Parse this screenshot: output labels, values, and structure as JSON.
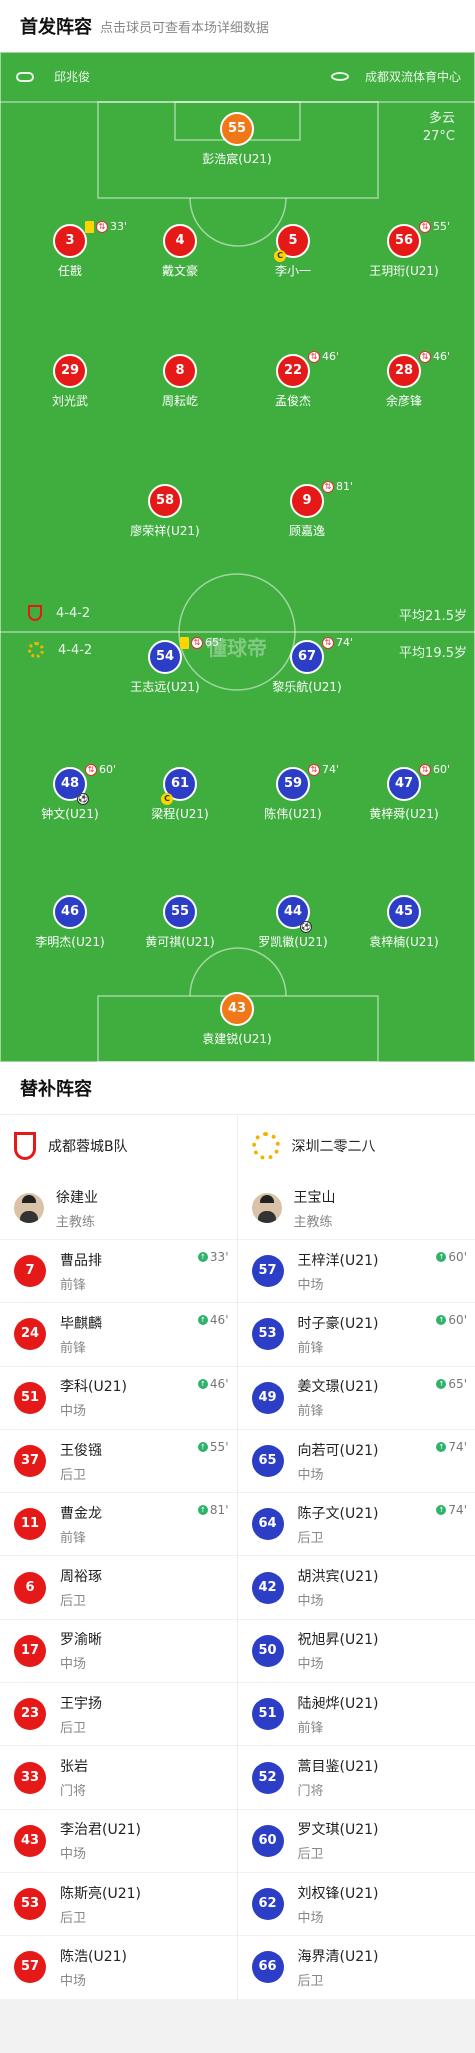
{
  "header": {
    "title": "首发阵容",
    "subtitle": "点击球员可查看本场详细数据"
  },
  "match": {
    "referee": "邱兆俊",
    "venue": "成都双流体育中心",
    "weather": "多云",
    "temperature": "27°C"
  },
  "watermark": "懂球帝",
  "home": {
    "formation": "4-4-2",
    "avg_age": "平均21.5岁",
    "players": [
      {
        "num": "55",
        "name": "彭浩宸(U21)",
        "gk": true
      },
      {
        "num": "3",
        "name": "任戡",
        "card": true,
        "sub_min": "33'"
      },
      {
        "num": "4",
        "name": "戴文豪"
      },
      {
        "num": "5",
        "name": "李小一",
        "captain": true
      },
      {
        "num": "56",
        "name": "王玥珩(U21)",
        "sub_min": "55'"
      },
      {
        "num": "29",
        "name": "刘光武"
      },
      {
        "num": "8",
        "name": "周耘屹"
      },
      {
        "num": "22",
        "name": "孟俊杰",
        "sub_min": "46'"
      },
      {
        "num": "28",
        "name": "余彦锋",
        "sub_min": "46'"
      },
      {
        "num": "58",
        "name": "廖荣祥(U21)"
      },
      {
        "num": "9",
        "name": "顾嘉逸",
        "sub_min": "81'"
      }
    ]
  },
  "away": {
    "formation": "4-4-2",
    "avg_age": "平均19.5岁",
    "players": [
      {
        "num": "54",
        "name": "王志远(U21)",
        "card": true,
        "sub_min": "65'"
      },
      {
        "num": "67",
        "name": "黎乐航(U21)",
        "sub_min": "74'"
      },
      {
        "num": "48",
        "name": "钟文(U21)",
        "sub_min": "60'",
        "goal": true
      },
      {
        "num": "61",
        "name": "梁程(U21)",
        "captain": true
      },
      {
        "num": "59",
        "name": "陈伟(U21)",
        "sub_min": "74'"
      },
      {
        "num": "47",
        "name": "黄梓舜(U21)",
        "sub_min": "60'"
      },
      {
        "num": "46",
        "name": "李明杰(U21)"
      },
      {
        "num": "55",
        "name": "黄可祺(U21)"
      },
      {
        "num": "44",
        "name": "罗凯徽(U21)",
        "goal": true
      },
      {
        "num": "45",
        "name": "袁梓楠(U21)"
      },
      {
        "num": "43",
        "name": "袁建锐(U21)",
        "gk": true
      }
    ]
  },
  "subs": {
    "title": "替补阵容",
    "home": {
      "team": "成都蓉城B队",
      "coach": "徐建业",
      "coach_role": "主教练",
      "players": [
        {
          "num": "7",
          "name": "曹品排",
          "pos": "前锋",
          "min": "33'"
        },
        {
          "num": "24",
          "name": "毕麒麟",
          "pos": "前锋",
          "min": "46'"
        },
        {
          "num": "51",
          "name": "李科(U21)",
          "pos": "中场",
          "min": "46'"
        },
        {
          "num": "37",
          "name": "王俊镪",
          "pos": "后卫",
          "min": "55'"
        },
        {
          "num": "11",
          "name": "曹金龙",
          "pos": "前锋",
          "min": "81'"
        },
        {
          "num": "6",
          "name": "周裕琢",
          "pos": "后卫"
        },
        {
          "num": "17",
          "name": "罗渝晰",
          "pos": "中场"
        },
        {
          "num": "23",
          "name": "王宇扬",
          "pos": "后卫"
        },
        {
          "num": "33",
          "name": "张岩",
          "pos": "门将"
        },
        {
          "num": "43",
          "name": "李治君(U21)",
          "pos": "中场"
        },
        {
          "num": "53",
          "name": "陈斯亮(U21)",
          "pos": "后卫"
        },
        {
          "num": "57",
          "name": "陈浩(U21)",
          "pos": "中场"
        }
      ]
    },
    "away": {
      "team": "深圳二零二八",
      "coach": "王宝山",
      "coach_role": "主教练",
      "players": [
        {
          "num": "57",
          "name": "王梓洋(U21)",
          "pos": "中场",
          "min": "60'"
        },
        {
          "num": "53",
          "name": "时子豪(U21)",
          "pos": "前锋",
          "min": "60'"
        },
        {
          "num": "49",
          "name": "姜文璟(U21)",
          "pos": "前锋",
          "min": "65'"
        },
        {
          "num": "65",
          "name": "向若可(U21)",
          "pos": "中场",
          "min": "74'"
        },
        {
          "num": "64",
          "name": "陈子文(U21)",
          "pos": "后卫",
          "min": "74'"
        },
        {
          "num": "42",
          "name": "胡洪宾(U21)",
          "pos": "中场"
        },
        {
          "num": "50",
          "name": "祝旭昇(U21)",
          "pos": "中场"
        },
        {
          "num": "51",
          "name": "陆昶烨(U21)",
          "pos": "前锋"
        },
        {
          "num": "52",
          "name": "蒿目鉴(U21)",
          "pos": "门将"
        },
        {
          "num": "60",
          "name": "罗文琪(U21)",
          "pos": "后卫"
        },
        {
          "num": "62",
          "name": "刘权锋(U21)",
          "pos": "中场"
        },
        {
          "num": "66",
          "name": "海界清(U21)",
          "pos": "后卫"
        }
      ]
    }
  },
  "colors": {
    "home": "#e61919",
    "away": "#2c3ec5",
    "gk": "#f07818",
    "pitch": "#3fae3f"
  }
}
